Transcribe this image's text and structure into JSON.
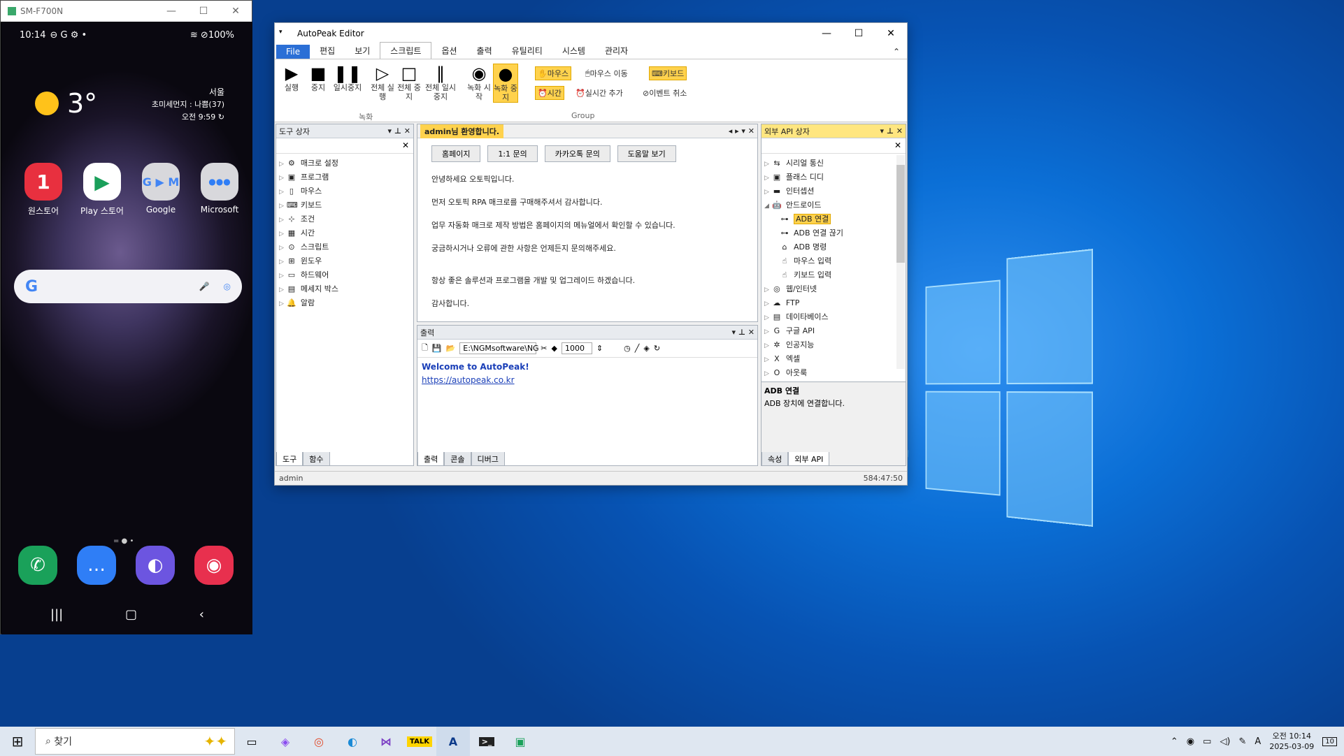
{
  "phone": {
    "window_title": "SM-F700N",
    "status_time": "10:14",
    "status_icons": "⊖ G ⚙ •",
    "battery": "100%",
    "temperature": "3°",
    "city": "서울",
    "dust": "초미세먼지 : 나쁨(37)",
    "updated": "오전 9:59",
    "apps": [
      {
        "label": "원스토어",
        "glyph": "1",
        "color": "#e8303f"
      },
      {
        "label": "Play 스토어",
        "glyph": "▶",
        "color": "#ffffff"
      },
      {
        "label": "Google",
        "glyph": "G",
        "color": "#d8d8dc"
      },
      {
        "label": "Microsoft",
        "glyph": "●●●",
        "color": "#d8d8dc"
      }
    ],
    "dock": [
      {
        "name": "phone-app",
        "glyph": "✆",
        "color": "#1aa15a"
      },
      {
        "name": "messages-app",
        "glyph": "…",
        "color": "#2f7ef6"
      },
      {
        "name": "internet-app",
        "glyph": "◐",
        "color": "#6c55e0"
      },
      {
        "name": "camera-app",
        "glyph": "◉",
        "color": "#e8304e"
      }
    ]
  },
  "editor": {
    "title": "AutoPeak Editor",
    "menu": [
      "File",
      "편집",
      "보기",
      "스크립트",
      "옵션",
      "출력",
      "유틸리티",
      "시스템",
      "관리자"
    ],
    "ribbon_buttons": [
      {
        "label": "실행",
        "glyph": "▶"
      },
      {
        "label": "중지",
        "glyph": "■"
      },
      {
        "label": "일시중지",
        "glyph": "❚❚"
      },
      {
        "label": "전체 실행",
        "glyph": "▷"
      },
      {
        "label": "전체 중지",
        "glyph": "□"
      },
      {
        "label": "전체 일시중지",
        "glyph": "‖"
      },
      {
        "label": "녹화 시작",
        "glyph": "◉"
      },
      {
        "label": "녹화 중지",
        "glyph": "●"
      }
    ],
    "ribbon_small": {
      "mouse": "마우스",
      "mouse_move": "마우스 이동",
      "keyboard": "키보드",
      "time": "시간",
      "realtime_add": "실시간 추가",
      "event_cancel": "이벤트 취소"
    },
    "group_record": "녹화",
    "group_group": "Group",
    "toolbox": {
      "title": "도구 상자",
      "items": [
        "매크로 설정",
        "프로그램",
        "마우스",
        "키보드",
        "조건",
        "시간",
        "스크립트",
        "윈도우",
        "하드웨어",
        "메세지 박스",
        "알람"
      ],
      "tabs": [
        "도구",
        "함수"
      ]
    },
    "welcome": {
      "tab": "admin님 환영합니다.",
      "buttons": [
        "홈페이지",
        "1:1 문의",
        "카카오톡 문의",
        "도움말 보기"
      ],
      "lines": [
        "안녕하세요 오토픽입니다.",
        "먼저 오토픽 RPA 매크로를 구매해주셔서 감사합니다.",
        "업무 자동화 매크로 제작 방법은 홈페이지의 메뉴얼에서 확인할 수 있습니다.",
        "궁금하시거나 오류에 관한 사항은 언제든지 문의해주세요.",
        "항상 좋은 솔루션과 프로그램을 개발 및 업그레이드 하겠습니다.",
        "감사합니다."
      ]
    },
    "output": {
      "title": "출력",
      "path": "E:\\NGMsoftware\\NG",
      "interval": "1000",
      "line1": "Welcome to AutoPeak!",
      "line2": "https://autopeak.co.kr",
      "tabs": [
        "출력",
        "콘솔",
        "디버그"
      ]
    },
    "api": {
      "title": "외부 API 상자",
      "items": [
        {
          "label": "시리얼 통신",
          "level": 0
        },
        {
          "label": "플래스 디디",
          "level": 0
        },
        {
          "label": "인터셉션",
          "level": 0
        },
        {
          "label": "안드로이드",
          "level": 0
        },
        {
          "label": "ADB 연결",
          "level": 1,
          "selected": true
        },
        {
          "label": "ADB 연결 끊기",
          "level": 1
        },
        {
          "label": "ADB 명령",
          "level": 1
        },
        {
          "label": "마우스 입력",
          "level": 1
        },
        {
          "label": "키보드 입력",
          "level": 1
        },
        {
          "label": "웹/인터넷",
          "level": 0
        },
        {
          "label": "FTP",
          "level": 0
        },
        {
          "label": "데이타베이스",
          "level": 0
        },
        {
          "label": "구글 API",
          "level": 0
        },
        {
          "label": "인공지능",
          "level": 0
        },
        {
          "label": "엑셀",
          "level": 0
        },
        {
          "label": "아웃룩",
          "level": 0
        }
      ],
      "desc_title": "ADB 연결",
      "desc_text": "ADB 장치에 연결합니다.",
      "tabs": [
        "속성",
        "외부 API"
      ]
    },
    "status_user": "admin",
    "status_time": "584:47:50"
  },
  "taskbar": {
    "search_placeholder": "찾기",
    "clock_time": "오전 10:14",
    "clock_date": "2025-03-09",
    "notif_count": "10",
    "ime": "A"
  }
}
